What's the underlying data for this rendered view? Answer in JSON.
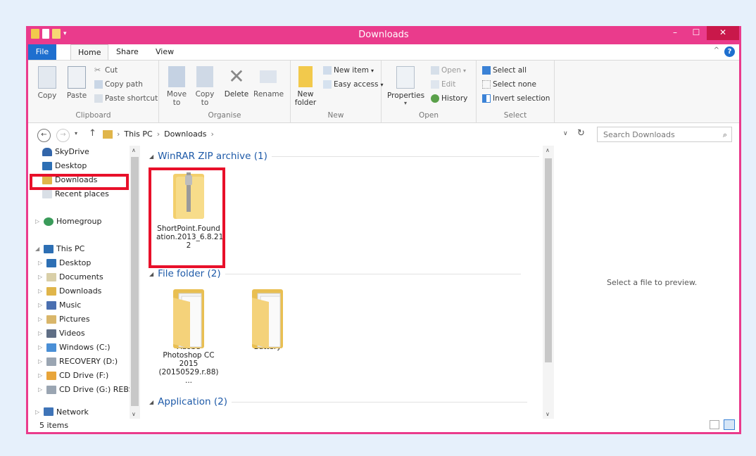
{
  "window": {
    "title": "Downloads",
    "minimize": "–",
    "maximize": "☐",
    "close": "✕"
  },
  "tabs": {
    "file": "File",
    "home": "Home",
    "share": "Share",
    "view": "View",
    "help": "?",
    "collapse": "^"
  },
  "ribbon": {
    "clipboard": {
      "label": "Clipboard",
      "copy": "Copy",
      "paste": "Paste",
      "cut": "Cut",
      "copy_path": "Copy path",
      "paste_shortcut": "Paste shortcut"
    },
    "organise": {
      "label": "Organise",
      "move_to_1": "Move",
      "move_to_2": "to",
      "copy_to_1": "Copy",
      "copy_to_2": "to",
      "delete": "Delete",
      "rename": "Rename"
    },
    "new": {
      "label": "New",
      "new_folder_1": "New",
      "new_folder_2": "folder",
      "new_item": "New item",
      "easy_access": "Easy access"
    },
    "open": {
      "label": "Open",
      "properties": "Properties",
      "open": "Open",
      "edit": "Edit",
      "history": "History"
    },
    "select": {
      "label": "Select",
      "select_all": "Select all",
      "select_none": "Select none",
      "invert": "Invert selection"
    }
  },
  "address": {
    "crumbs": [
      "This PC",
      "Downloads"
    ],
    "search_placeholder": "Search Downloads"
  },
  "nav": {
    "skydrive": "SkyDrive",
    "desktop": "Desktop",
    "downloads": "Downloads",
    "recent": "Recent places",
    "homegroup": "Homegroup",
    "thispc": "This PC",
    "pc_items": [
      "Desktop",
      "Documents",
      "Downloads",
      "Music",
      "Pictures",
      "Videos",
      "Windows (C:)",
      "RECOVERY (D:)",
      "CD Drive (F:)",
      "CD Drive (G:) REBS"
    ],
    "network": "Network"
  },
  "content": {
    "groups": [
      {
        "title": "WinRAR ZIP archive (1)"
      },
      {
        "title": "File folder (2)"
      },
      {
        "title": "Application (2)"
      }
    ],
    "zip_file": {
      "line1": "ShortPoint.Found",
      "line2": "ation.2013_6.8.21.",
      "line3": "2"
    },
    "folder1": {
      "line1": "Adobe",
      "line2": "Photoshop CC",
      "line3": "2015",
      "line4": "(20150529.r.88) ..."
    },
    "folder2": {
      "line1": "Battery"
    }
  },
  "preview": {
    "text": "Select a file to preview."
  },
  "status": {
    "count": "5 items"
  },
  "colors": {
    "accent": "#ea3b8c",
    "file_tab": "#1e6fcf",
    "highlight": "#e8102a"
  }
}
